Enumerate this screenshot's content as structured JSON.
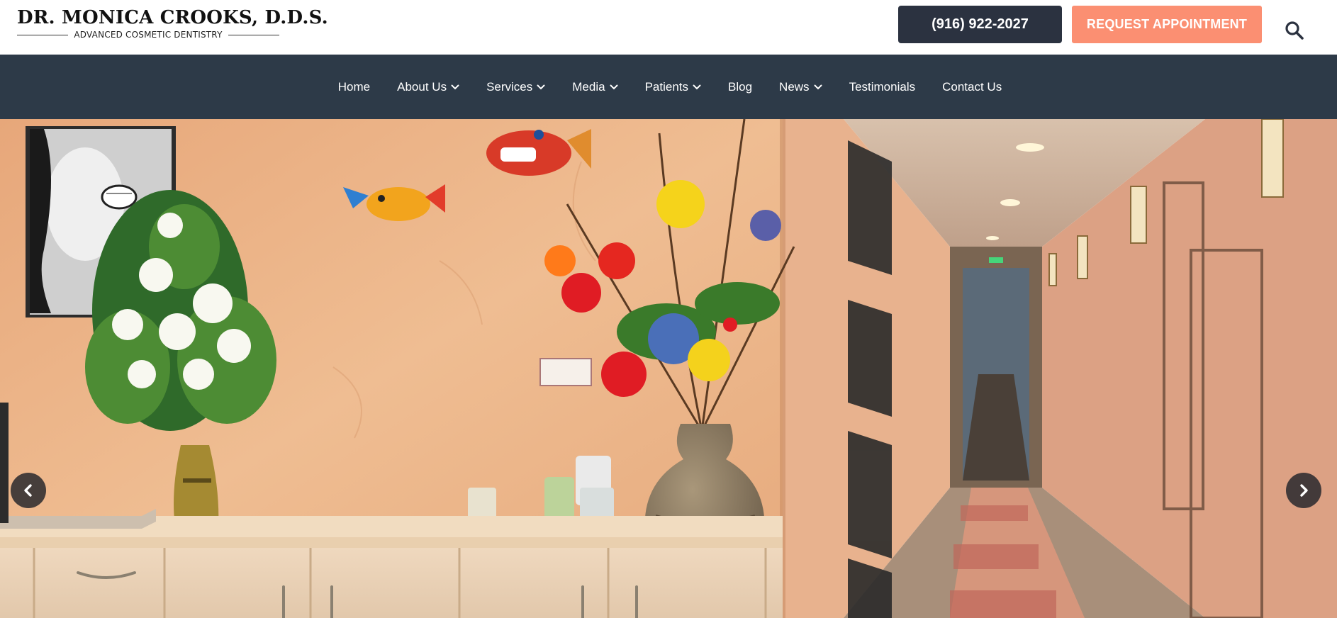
{
  "header": {
    "logo_name": "DR. MONICA CROOKS, D.D.S.",
    "logo_tagline": "ADVANCED COSMETIC DENTISTRY",
    "phone": "(916) 922-2027",
    "appointment_label": "REQUEST APPOINTMENT",
    "search_icon": "search-icon"
  },
  "nav": {
    "items": [
      {
        "label": "Home",
        "dropdown": false
      },
      {
        "label": "About Us",
        "dropdown": true
      },
      {
        "label": "Services",
        "dropdown": true
      },
      {
        "label": "Media",
        "dropdown": true
      },
      {
        "label": "Patients",
        "dropdown": true
      },
      {
        "label": "Blog",
        "dropdown": false
      },
      {
        "label": "News",
        "dropdown": true
      },
      {
        "label": "Testimonials",
        "dropdown": false
      },
      {
        "label": "Contact Us",
        "dropdown": false
      }
    ]
  },
  "hero": {
    "prev_icon": "chevron-left-icon",
    "next_icon": "chevron-right-icon"
  },
  "colors": {
    "phone_button": "#2b3240",
    "appointment_button": "#fb8f72",
    "nav_background": "#2d3a48",
    "wall": "#e9b488"
  }
}
